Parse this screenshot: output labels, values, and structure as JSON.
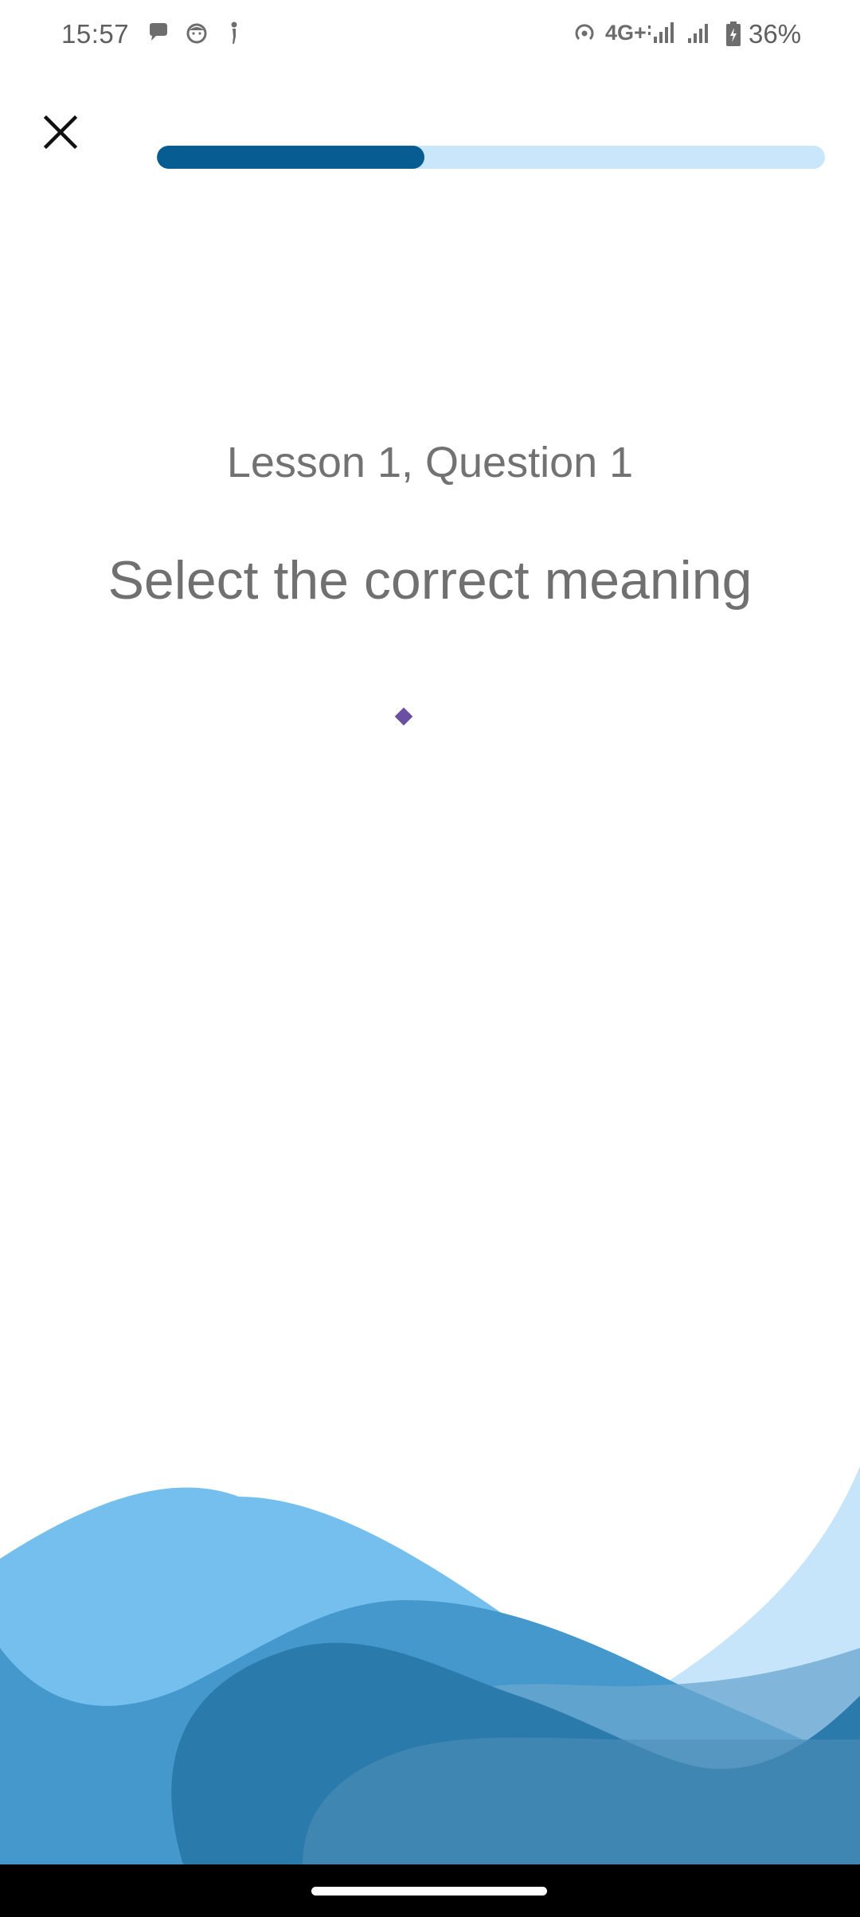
{
  "status_bar": {
    "time": "15:57",
    "network": "4G+",
    "battery": "36%",
    "icons": [
      "chat-bubble-icon",
      "cat-face-icon",
      "person-icon",
      "hotspot-icon",
      "signal-strength-icon",
      "signal-strength-icon",
      "battery-charging-icon"
    ]
  },
  "toolbar": {
    "close_icon": "close-icon"
  },
  "progress": {
    "fraction": 0.4
  },
  "lesson": {
    "label": "Lesson 1, Question 1",
    "instruction": "Select the correct meaning"
  },
  "colors": {
    "progress_fill": "#075c92",
    "progress_track": "#c9e6fb",
    "wave_light": "#74bfed",
    "wave_mid": "#4498cc",
    "wave_dark": "#2a7aab",
    "spinner": "#6a4fa3"
  }
}
